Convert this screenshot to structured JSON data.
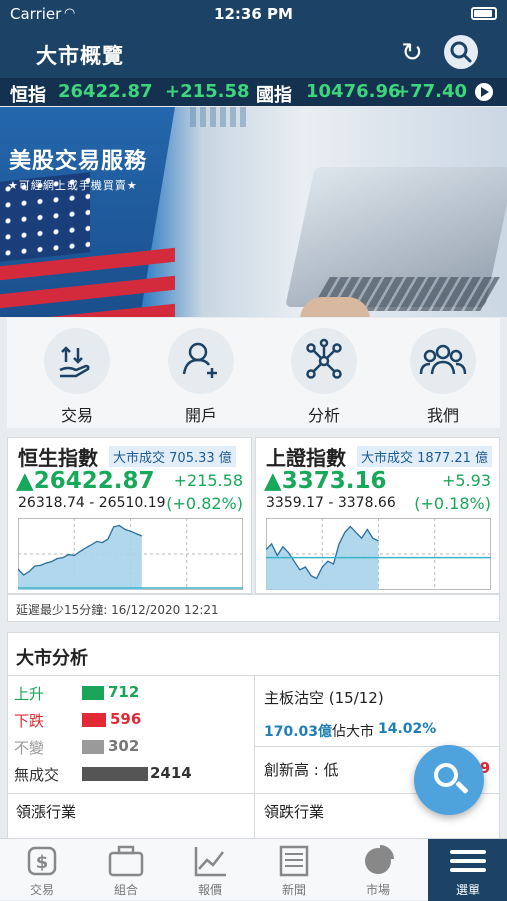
{
  "status_bar": {
    "carrier": "Carrier",
    "time": "12:36 PM"
  },
  "header": {
    "title": "大市概覽"
  },
  "ticker": {
    "items": [
      {
        "name": "恒指",
        "value": "26422.87",
        "change": "+215.58"
      },
      {
        "name": "國指",
        "value": "10476.96",
        "change": "+77.40"
      }
    ]
  },
  "banner": {
    "title": "美股交易服務",
    "subtitle": "★可經網上或手機買賣★"
  },
  "quick_actions": [
    {
      "label": "交易",
      "icon": "trade-hand-icon"
    },
    {
      "label": "開戶",
      "icon": "add-user-icon"
    },
    {
      "label": "分析",
      "icon": "network-icon"
    },
    {
      "label": "我們",
      "icon": "group-icon"
    }
  ],
  "indices": [
    {
      "name": "恒生指數",
      "turnover_label": "大市成交",
      "turnover": "705.33 億",
      "price": "▲26422.87",
      "change": "+215.58",
      "range": "26318.74 - 26510.19",
      "percent": "(+0.82%)",
      "series": [
        26360,
        26340,
        26352,
        26370,
        26372,
        26380,
        26385,
        26395,
        26398,
        26408,
        26405,
        26418,
        26430,
        26440,
        26452,
        26448,
        26460,
        26500,
        26505,
        26492,
        26486,
        26478,
        26470
      ],
      "prev_close": 26207.29,
      "ylim": [
        26290,
        26530
      ]
    },
    {
      "name": "上證指數",
      "turnover_label": "大市成交",
      "turnover": "1877.21 億",
      "price": "▲3373.16",
      "change": "+5.93",
      "range": "3359.17 - 3378.66",
      "percent": "(+0.18%)",
      "series": [
        3370,
        3372,
        3368,
        3371,
        3369,
        3366,
        3363,
        3364,
        3361,
        3360,
        3364,
        3366,
        3365,
        3372,
        3376,
        3378,
        3376,
        3374,
        3377,
        3374,
        3373
      ],
      "prev_close": 3367.23,
      "ylim": [
        3356,
        3381
      ]
    }
  ],
  "delay_note": "延遲最少15分鐘: 16/12/2020 12:21",
  "analysis": {
    "title": "大市分析",
    "breadth": [
      {
        "label": "上升",
        "value": "712",
        "color": "#1aa55a",
        "fraction": 0.29
      },
      {
        "label": "下跌",
        "value": "596",
        "color": "#e02b36",
        "fraction": 0.25
      },
      {
        "label": "不變",
        "value": "302",
        "color": "#9a9a9a",
        "fraction": 0.13
      },
      {
        "label": "無成交",
        "value": "2414",
        "color": "#555555",
        "fraction": 0.6
      }
    ],
    "short_title": "主板沽空 (15/12)",
    "short_value": "170.03億",
    "short_pct_label": "佔大市",
    "short_pct": "14.02%",
    "new_high_label": "創新高 : 低",
    "new_high_value": "51 : 29",
    "leaders_up": "領漲行業",
    "leaders_down": "領跌行業"
  },
  "tabs": [
    {
      "label": "交易",
      "icon": "dollar-icon"
    },
    {
      "label": "組合",
      "icon": "briefcase-icon"
    },
    {
      "label": "報價",
      "icon": "chart-icon"
    },
    {
      "label": "新聞",
      "icon": "newspaper-icon"
    },
    {
      "label": "市場",
      "icon": "pie-icon"
    },
    {
      "label": "選單",
      "icon": "menu-icon"
    }
  ]
}
